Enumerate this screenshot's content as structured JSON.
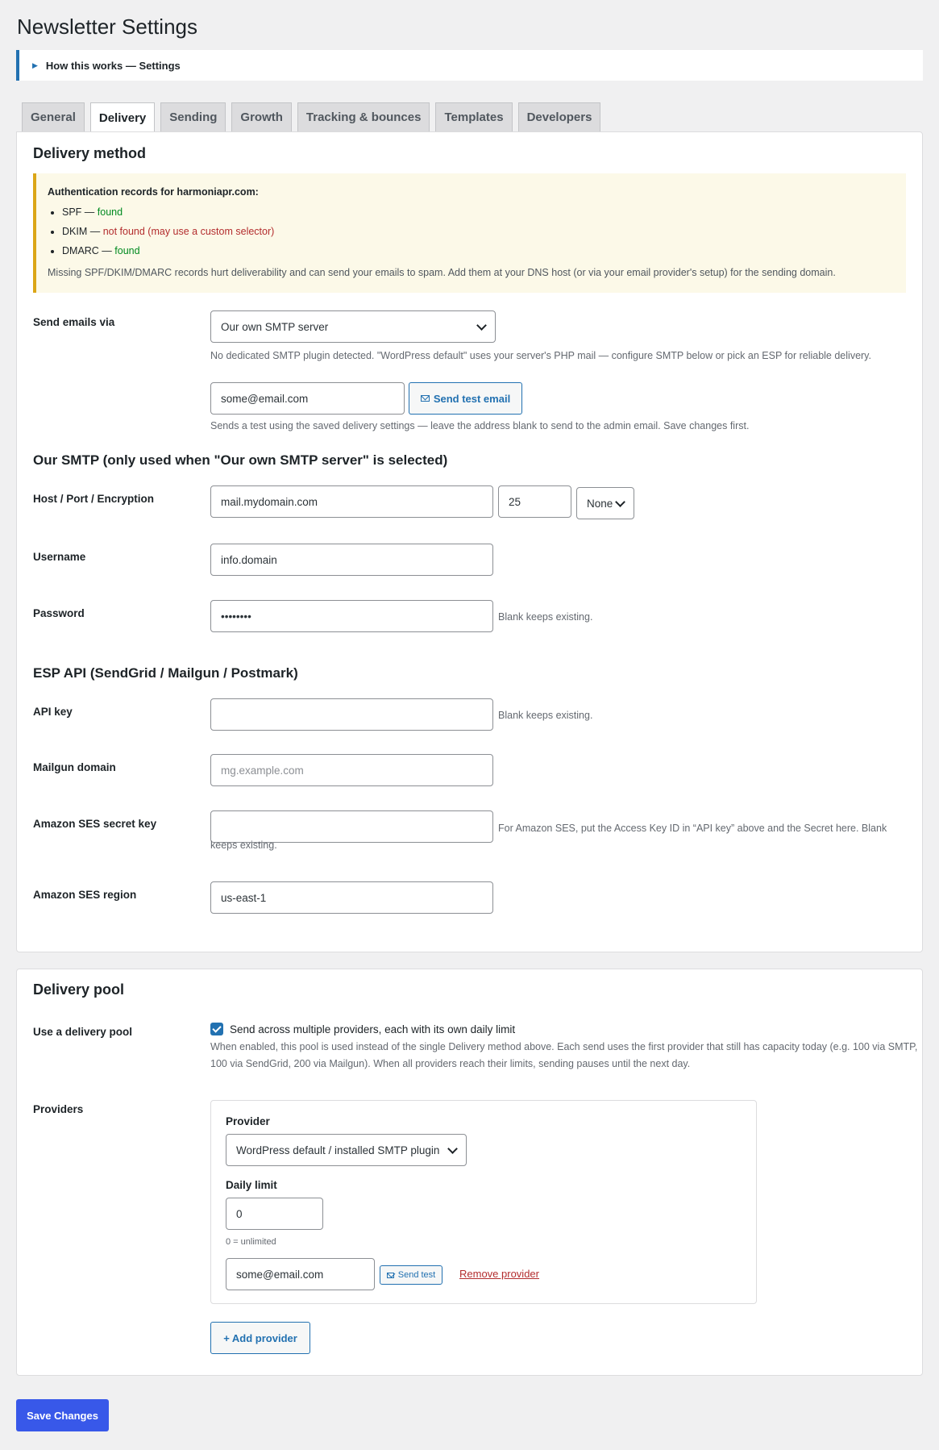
{
  "page_title": "Newsletter Settings",
  "howbox_label": "How this works — Settings",
  "tabs": [
    "General",
    "Delivery",
    "Sending",
    "Growth",
    "Tracking & bounces",
    "Templates",
    "Developers"
  ],
  "delivery": {
    "heading": "Delivery method",
    "notice": {
      "title": "Authentication records for harmoniapr.com:",
      "spf_name": "SPF — ",
      "spf_status": "found",
      "dkim_name": "DKIM — ",
      "dkim_status": "not found (may use a custom selector)",
      "dmarc_name": "DMARC — ",
      "dmarc_status": "found",
      "footer": "Missing SPF/DKIM/DMARC records hurt deliverability and can send your emails to spam. Add them at your DNS host (or via your email provider's setup) for the sending domain."
    },
    "send_via_label": "Send emails via",
    "send_via_value": "Our own SMTP server",
    "send_via_desc": "No dedicated SMTP plugin detected. \"WordPress default\" uses your server's PHP mail — configure SMTP below or pick an ESP for reliable delivery.",
    "test_email_value": "some@email.com",
    "send_test_label": "Send test email",
    "test_desc": "Sends a test using the saved delivery settings — leave the address blank to send to the admin email. Save changes first."
  },
  "smtp": {
    "heading": "Our SMTP (only used when \"Our own SMTP server\" is selected)",
    "host_label": "Host / Port / Encryption",
    "host_value": "mail.mydomain.com",
    "port_value": "25",
    "encryption_value": "None",
    "username_label": "Username",
    "username_value": "info.domain",
    "password_label": "Password",
    "password_value": "••••••••",
    "password_hint": "Blank keeps existing."
  },
  "esp": {
    "heading": "ESP API (SendGrid / Mailgun / Postmark)",
    "api_key_label": "API key",
    "api_key_hint": "Blank keeps existing.",
    "mailgun_label": "Mailgun domain",
    "mailgun_placeholder": "mg.example.com",
    "ses_secret_label": "Amazon SES secret key",
    "ses_secret_hint": "For Amazon SES, put the Access Key ID in “API key” above and the Secret here. Blank keeps existing.",
    "ses_region_label": "Amazon SES region",
    "ses_region_value": "us-east-1"
  },
  "pool": {
    "heading": "Delivery pool",
    "use_label": "Use a delivery pool",
    "use_checked": true,
    "use_checkbox_label": "Send across multiple providers, each with its own daily limit",
    "use_desc": "When enabled, this pool is used instead of the single Delivery method above. Each send uses the first provider that still has capacity today (e.g. 100 via SMTP, 100 via SendGrid, 200 via Mailgun). When all providers reach their limits, sending pauses until the next day.",
    "providers_label": "Providers",
    "provider_field_label": "Provider",
    "provider_value": "WordPress default / installed SMTP plugin",
    "daily_limit_label": "Daily limit",
    "daily_limit_value": "0",
    "daily_limit_hint": "0 = unlimited",
    "test_email_value": "some@email.com",
    "send_test_label": "Send test",
    "remove_label": "Remove provider",
    "add_provider_label": "+ Add provider"
  },
  "save_label": "Save Changes"
}
